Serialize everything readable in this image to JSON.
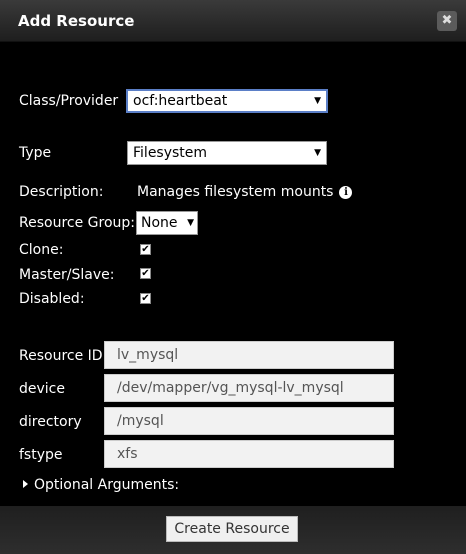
{
  "dialog": {
    "title": "Add Resource",
    "close_glyph": "✖"
  },
  "form": {
    "class_provider": {
      "label": "Class/Provider",
      "value": "ocf:heartbeat"
    },
    "type": {
      "label": "Type",
      "value": "Filesystem"
    },
    "description": {
      "label": "Description:",
      "value": "Manages filesystem mounts",
      "icon": "info-icon"
    },
    "resource_group": {
      "label": "Resource Group:",
      "value": "None"
    },
    "clone": {
      "label": "Clone:",
      "checked": true
    },
    "master_slave": {
      "label": "Master/Slave:",
      "checked": true
    },
    "disabled": {
      "label": "Disabled:",
      "checked": true
    },
    "resource_id": {
      "label": "Resource ID",
      "value": "lv_mysql"
    },
    "device": {
      "label": "device",
      "value": "/dev/mapper/vg_mysql-lv_mysql"
    },
    "directory": {
      "label": "directory",
      "value": "/mysql"
    },
    "fstype": {
      "label": "fstype",
      "value": "xfs"
    },
    "optional_arguments": {
      "label": "Optional Arguments:"
    }
  },
  "footer": {
    "create_label": "Create Resource"
  },
  "glyphs": {
    "select_arrow": "▼",
    "check": "✔"
  }
}
